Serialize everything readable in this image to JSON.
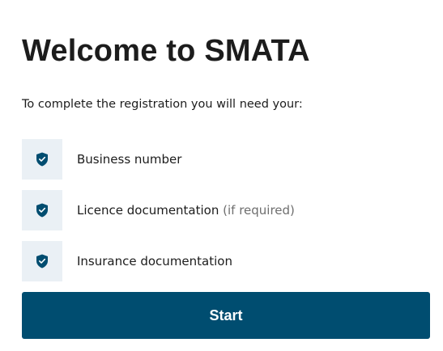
{
  "page": {
    "title": "Welcome to SMATA",
    "intro": "To complete the registration you will need your:"
  },
  "requirements": [
    {
      "icon": "shield-check-icon",
      "label": "Business number",
      "note": ""
    },
    {
      "icon": "shield-check-icon",
      "label": "Licence documentation",
      "note": "(if required)"
    },
    {
      "icon": "shield-check-icon",
      "label": "Insurance documentation",
      "note": ""
    }
  ],
  "actions": {
    "start_label": "Start"
  },
  "colors": {
    "primary": "#004d70",
    "icon_bg": "#eaf0f5",
    "text": "#1c1c1c",
    "muted": "#6e6e6e"
  }
}
